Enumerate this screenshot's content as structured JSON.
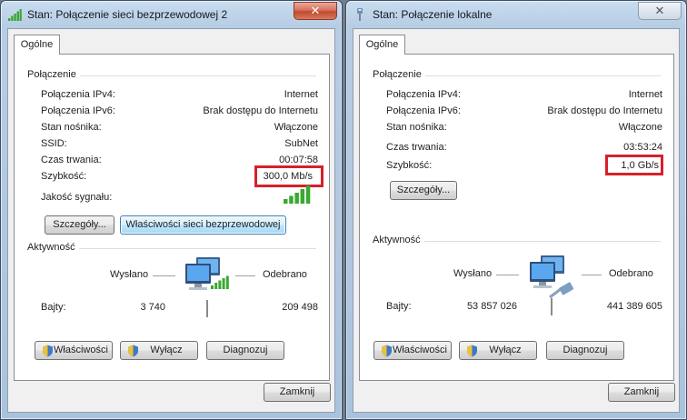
{
  "windows": [
    {
      "title": "Stan: Połączenie sieci bezprzewodowej 2",
      "tab": "Ogólne",
      "connection_group": "Połączenie",
      "rows": [
        {
          "label": "Połączenia IPv4:",
          "value": "Internet"
        },
        {
          "label": "Połączenia IPv6:",
          "value": "Brak dostępu do Internetu"
        },
        {
          "label": "Stan nośnika:",
          "value": "Włączone"
        },
        {
          "label": "SSID:",
          "value": "SubNet"
        },
        {
          "label": "Czas trwania:",
          "value": "00:07:58"
        },
        {
          "label": "Szybkość:",
          "value": "300,0 Mb/s"
        }
      ],
      "signal_label": "Jakość sygnału:",
      "signal_level": 5,
      "details_button": "Szczegóły...",
      "wireless_props_button": "Właściwości sieci bezprzewodowej",
      "activity_group": "Aktywność",
      "sent_label": "Wysłano",
      "received_label": "Odebrano",
      "bytes_label": "Bajty:",
      "bytes_sent": "3 740",
      "bytes_received": "209 498",
      "properties_button": "Właściwości",
      "disable_button": "Wyłącz",
      "diagnose_button": "Diagnozuj",
      "close_button": "Zamknij",
      "close_icon": "close-icon",
      "title_icon": "wireless-signal-icon"
    },
    {
      "title": "Stan: Połączenie lokalne",
      "tab": "Ogólne",
      "connection_group": "Połączenie",
      "rows": [
        {
          "label": "Połączenia IPv4:",
          "value": "Internet"
        },
        {
          "label": "Połączenia IPv6:",
          "value": "Brak dostępu do Internetu"
        },
        {
          "label": "Stan nośnika:",
          "value": "Włączone"
        },
        {
          "label": "Czas trwania:",
          "value": "03:53:24"
        },
        {
          "label": "Szybkość:",
          "value": "1,0 Gb/s"
        }
      ],
      "details_button": "Szczegóły...",
      "activity_group": "Aktywność",
      "sent_label": "Wysłano",
      "received_label": "Odebrano",
      "bytes_label": "Bajty:",
      "bytes_sent": "53 857 026",
      "bytes_received": "441 389 605",
      "properties_button": "Właściwości",
      "disable_button": "Wyłącz",
      "diagnose_button": "Diagnozuj",
      "close_button": "Zamknij",
      "close_icon": "close-icon",
      "title_icon": "ethernet-plug-icon"
    }
  ],
  "colors": {
    "highlight": "#d7202a",
    "signal_green": "#3aa832",
    "focus_border": "#3c7fb1"
  }
}
